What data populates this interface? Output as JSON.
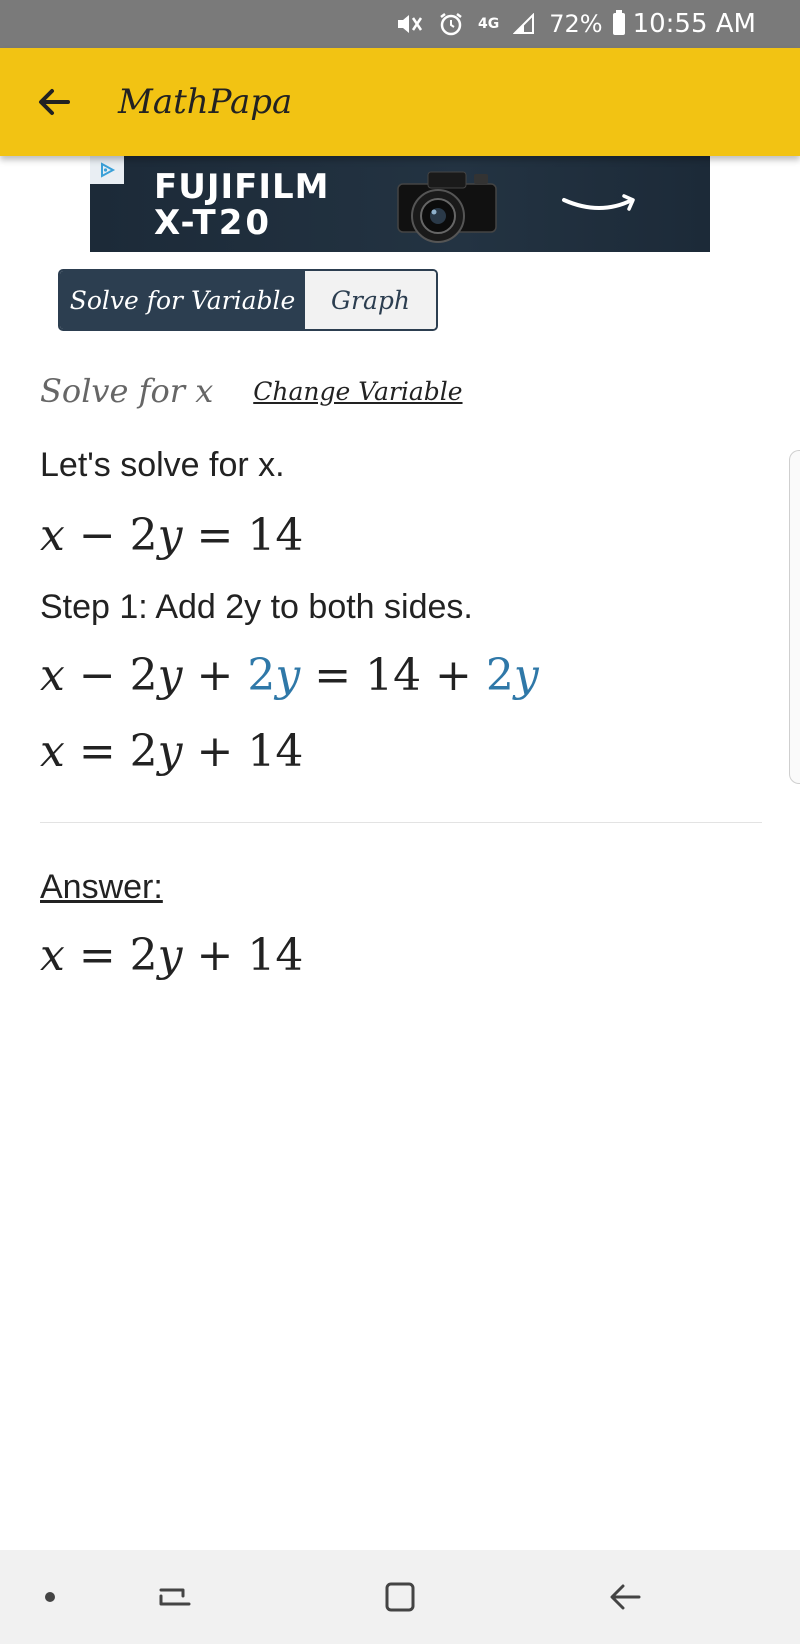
{
  "status_bar": {
    "battery": "72%",
    "time": "10:55 AM",
    "network": "4G",
    "icons": [
      "mute-icon",
      "alarm-icon",
      "network-4g-icon",
      "signal-icon",
      "battery-icon"
    ]
  },
  "app_bar": {
    "title": "MathPapa",
    "back_icon": "arrow-left-icon",
    "color": "#f2c313"
  },
  "ad": {
    "brand": "FUJIFILM",
    "model": "X-T20",
    "badge_icon": "ad-choices-icon",
    "logo_icon": "amazon-smile-icon"
  },
  "tabs": {
    "active": "Solve for Variable",
    "inactive": "Graph",
    "active_color": "#2c3e50"
  },
  "solve": {
    "label": "Solve for x",
    "change_variable": "Change Variable",
    "intro": "Let's solve for x.",
    "equation": {
      "a": "x",
      "b": " − 2",
      "c": "y",
      "d": " = 14"
    },
    "step1_text": "Step 1: Add 2y to both sides.",
    "step1_eq": {
      "a": "x",
      "b": " − 2",
      "c": "y",
      "d": " + ",
      "e": "2",
      "f": "y",
      "g": " = 14 + ",
      "h": "2",
      "i": "y"
    },
    "result_eq": {
      "a": "x",
      "b": " = 2",
      "c": "y",
      "d": " + 14"
    },
    "highlight_color": "#2f78a8"
  },
  "answer": {
    "label": "Answer:",
    "eq": {
      "a": "x",
      "b": " = 2",
      "c": "y",
      "d": " + 14"
    }
  },
  "nav_bar": {
    "icons": [
      "dot-icon",
      "recent-apps-icon",
      "home-icon",
      "back-icon"
    ]
  }
}
